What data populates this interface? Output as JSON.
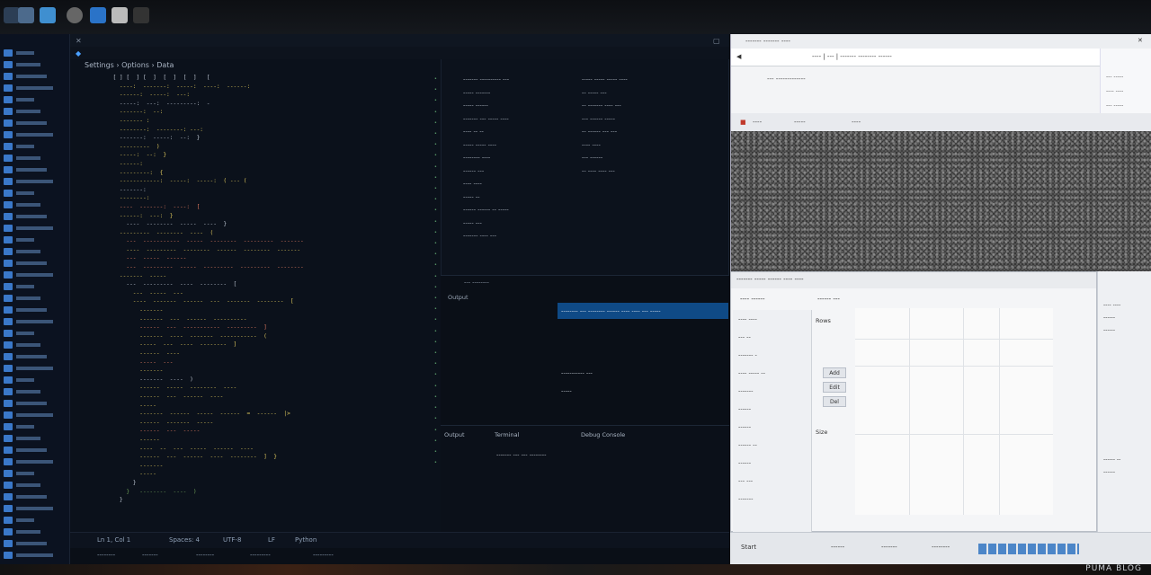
{
  "colors": {
    "editor_bg": "#0b111b",
    "accent_blue": "#0f4a86",
    "keyword": "#d9c35a",
    "string": "#e07a5f",
    "plain": "#b7c0cc",
    "comment": "#6a9955",
    "browser_bg": "#f3f4f6"
  },
  "editor": {
    "breadcrumb": "Settings  ›  Options  ›  Data",
    "code_lines": [
      {
        "t": "  [ ] [  ] [  ]  [  ]  [  ]   [",
        "c": "plain"
      },
      {
        "t": "    ----:  -------:  -----:  ----:  ------:",
        "c": "keyword"
      },
      {
        "t": "    ------:  -----:  ---:",
        "c": "keyword"
      },
      {
        "t": "    -----:  ---:  ---------:  -",
        "c": "plain"
      },
      {
        "t": "    -------:  --:",
        "c": "keyword"
      },
      {
        "t": "    ------- :",
        "c": "keyword"
      },
      {
        "t": "    --------:  --------: ---:",
        "c": "keyword"
      },
      {
        "t": "    -------:  -----:  --:  }",
        "c": "plain"
      },
      {
        "t": "    ---------  )",
        "c": "keyword"
      },
      {
        "t": "    -----:  --:  }",
        "c": "keyword"
      },
      {
        "t": "    ------:",
        "c": "keyword"
      },
      {
        "t": "    ---------:  {",
        "c": "keyword"
      },
      {
        "t": "    ------------:  -----:  -----:  ( --- (",
        "c": "keyword"
      },
      {
        "t": "    -------:",
        "c": "plain"
      },
      {
        "t": "    --------:",
        "c": "keyword"
      },
      {
        "t": "    ----  -------:  ----:  [",
        "c": "string"
      },
      {
        "t": "    ------:  ---:  }",
        "c": "keyword"
      },
      {
        "t": "      ----  --------  -----  ----  }",
        "c": "plain"
      },
      {
        "t": "    ---------  --------  ----  (",
        "c": "keyword"
      },
      {
        "t": "      ---  -----------  -----  --------  ---------  -------",
        "c": "string"
      },
      {
        "t": "      ----  ---------  --------  ------  --------  -------",
        "c": "keyword"
      },
      {
        "t": "      ---  -----  ------",
        "c": "string"
      },
      {
        "t": "      ---  ---------  -----  ---------  ---------  --------",
        "c": "string"
      },
      {
        "t": "    -------  -----",
        "c": "keyword"
      },
      {
        "t": "      ---  ---------  ----  --------  [",
        "c": "plain"
      },
      {
        "t": "        ---  -----  ---",
        "c": "keyword"
      },
      {
        "t": "        ----  -------  ------  ---  -------  --------  [",
        "c": "keyword"
      },
      {
        "t": "          -------",
        "c": "keyword"
      },
      {
        "t": "          -------  ---  ------  ----------",
        "c": "keyword"
      },
      {
        "t": "          ------  ---  -----------  ---------  ]",
        "c": "string"
      },
      {
        "t": "          -------  ----  -------  -----------  (",
        "c": "keyword"
      },
      {
        "t": "          -----  ---  ----  --------  ]",
        "c": "keyword"
      },
      {
        "t": "          ------  ----",
        "c": "keyword"
      },
      {
        "t": "          -----  ---",
        "c": "string"
      },
      {
        "t": "          -------",
        "c": "keyword"
      },
      {
        "t": "          -------  ----  )",
        "c": "plain"
      },
      {
        "t": "          ------  -----  --------  ----",
        "c": "keyword"
      },
      {
        "t": "          ------  ---  ------  ----",
        "c": "keyword"
      },
      {
        "t": "          -----",
        "c": "keyword"
      },
      {
        "t": "          -------  ------  -----  ------  =  ------  |>",
        "c": "keyword"
      },
      {
        "t": "          ------  -------  -----",
        "c": "keyword"
      },
      {
        "t": "          ------  ---  -----",
        "c": "string"
      },
      {
        "t": "          ------",
        "c": "keyword"
      },
      {
        "t": "          ----  --  ---  -----  ------  ----",
        "c": "keyword"
      },
      {
        "t": "          ------  ---  ------  ----  --------  ]  }",
        "c": "keyword"
      },
      {
        "t": "          -------",
        "c": "keyword"
      },
      {
        "t": "          -----",
        "c": "keyword"
      },
      {
        "t": "        }",
        "c": "plain"
      },
      {
        "t": "      }   --------  ----  )",
        "c": "comment"
      },
      {
        "t": "    }",
        "c": "plain"
      }
    ],
    "outline": [
      "------- ---------- ---",
      "  ----- -------",
      "  ----- ------",
      "  ------- --- ----- ----",
      "  ---- -- --",
      "  ----- ----- ----",
      "  -------- ----",
      "  ------ ---",
      "  ---- ----",
      "  ----- --",
      "  ------ ------ -- -----",
      "  ----- ---",
      "  ------- ---- ---"
    ],
    "outline_right": [
      "----- ----- ----- ----",
      "-- ----- ---",
      "-- ------- ---- ---",
      "--- ------ -----",
      "-- ------ --- ---",
      "---- ----",
      "--- ------",
      "-- ---- ---- ---"
    ],
    "problems_header": "--- --------",
    "problems_tab": "Output",
    "problems_selected": "-------- --- -------- ------ ---- ---- --- -----",
    "panel_lines": [
      "----------- ---",
      "-----"
    ],
    "bottom_tabs": [
      "Output",
      "Terminal",
      "Debug Console"
    ],
    "bottom_line": "------- --- --- --------",
    "status_left": "Ln 1, Col 1",
    "status_items": [
      "Spaces: 4",
      "UTF-8",
      "LF",
      "Python"
    ],
    "status2_items": [
      "--------",
      "-------",
      "--------",
      "---------",
      "---------"
    ]
  },
  "browser": {
    "title": "------- ------- ----",
    "url": "---- | --- | ------- -------- ------",
    "toolbar_text": "--- -------------",
    "bookmarks": [
      "----",
      "-----",
      "----"
    ],
    "side_items": [
      "--- -----",
      "---- ----",
      "--- -----",
      "-----"
    ]
  },
  "dialog": {
    "title": "------- ----- ------ ---- ----",
    "tab_left": "---- ------",
    "tab_right": "------ ---",
    "left_items": [
      "---- ----",
      "--- --",
      "------- -",
      "---- ----- --",
      "-------",
      "------",
      "------",
      "------ --",
      "------",
      "--- ---",
      "-------"
    ],
    "mid_label": "Rows",
    "buttons": [
      "Add",
      "Edit",
      "Del"
    ],
    "mid_label2": "Size",
    "right_items": [
      "---- ----",
      "------",
      "------",
      "------ --",
      "------"
    ]
  },
  "taskbar": {
    "items": [
      "Start",
      "------",
      "-------",
      "--------"
    ]
  },
  "corner_text": "PUMA BLOG"
}
